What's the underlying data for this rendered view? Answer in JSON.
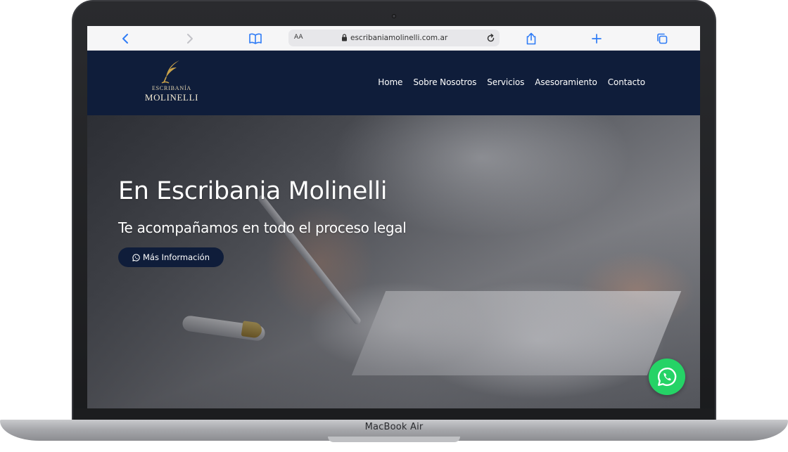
{
  "device": {
    "label": "MacBook Air"
  },
  "browser": {
    "text_size_label": "AA",
    "url": "escribaniamolinelli.com.ar"
  },
  "site": {
    "logo": {
      "top": "ESCRIBANÍA",
      "main": "MOLINELLI"
    },
    "nav": [
      "Home",
      "Sobre Nosotros",
      "Servicios",
      "Asesoramiento",
      "Contacto"
    ]
  },
  "hero": {
    "title": "En Escribania Molinelli",
    "subtitle": "Te acompañamos en todo el proceso legal",
    "cta_label": "Más Información"
  },
  "colors": {
    "header_bg": "#0f1d3a",
    "toolbar_blue": "#2f7cf6",
    "whatsapp_green": "#25d366",
    "logo_gold": "#c9a24a"
  },
  "icons": [
    "back-icon",
    "forward-icon",
    "bookmarks-icon",
    "lock-icon",
    "reload-icon",
    "share-icon",
    "new-tab-icon",
    "tabs-icon",
    "quill-icon",
    "whatsapp-icon"
  ]
}
